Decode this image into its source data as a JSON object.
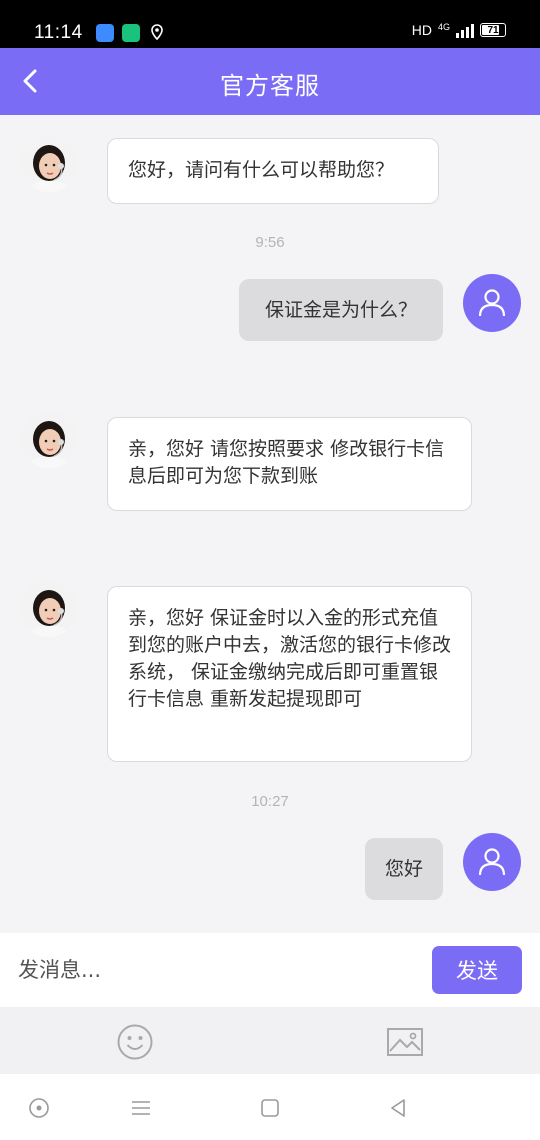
{
  "status_bar": {
    "time": "11:14",
    "network": "HD",
    "network_type": "4G",
    "battery": "71"
  },
  "header": {
    "title": "官方客服",
    "back_icon": "chevron-left-icon"
  },
  "messages": [
    {
      "from": "agent",
      "text": "您好，请问有什么可以帮助您？"
    },
    {
      "timestamp": "9:56"
    },
    {
      "from": "user",
      "text": "保证金是为什么？"
    },
    {
      "from": "agent",
      "text": "亲，您好 请您按照要求 修改银行卡信息后即可为您下款到账"
    },
    {
      "from": "agent",
      "text": "亲，您好 保证金时以入金的形式充值到您的账户中去，激活您的银行卡修改系统，  保证金缴纳完成后即可重置银行卡信息 重新发起提现即可"
    },
    {
      "timestamp": "10:27"
    },
    {
      "from": "user",
      "text": "您好"
    }
  ],
  "input": {
    "placeholder": "发消息...",
    "value": "",
    "send_label": "发送"
  },
  "tools": {
    "emoji_icon": "smiley-icon",
    "image_icon": "image-icon"
  },
  "colors": {
    "accent": "#7b6cf6",
    "user_bubble": "#dcdcdf",
    "agent_bubble": "#ffffff",
    "background": "#f4f4f6"
  }
}
